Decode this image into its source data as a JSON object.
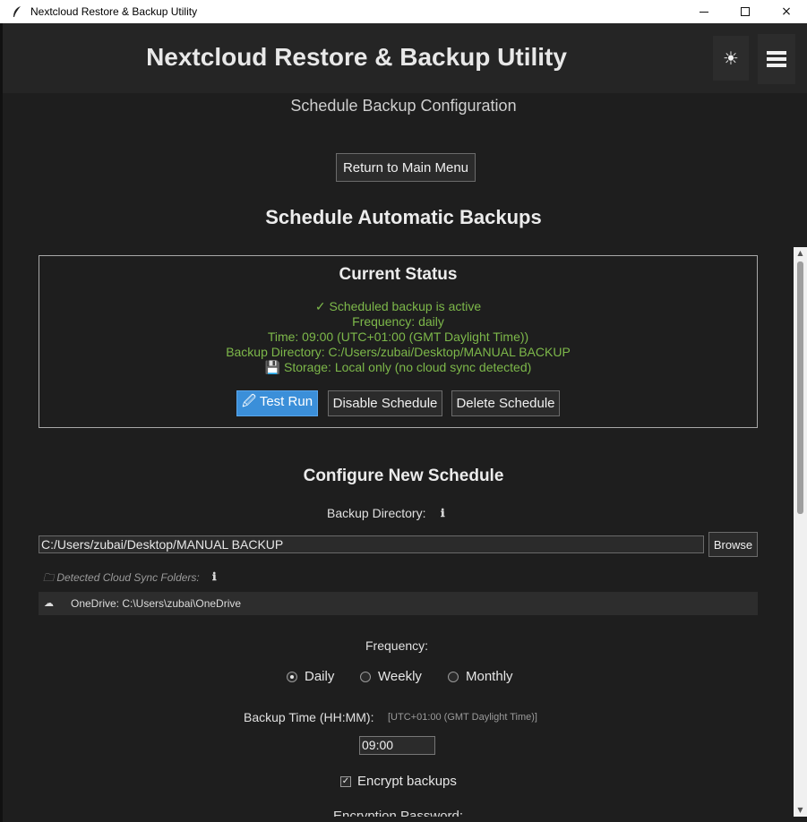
{
  "window": {
    "title": "Nextcloud Restore & Backup Utility",
    "app_icon": "feather-icon",
    "controls": {
      "minimize": "minimize-icon",
      "maximize": "maximize-icon",
      "close": "×"
    }
  },
  "header": {
    "title": "Nextcloud Restore & Backup Utility",
    "theme_icon": "☀",
    "menu_icon": "hamburger-icon"
  },
  "page": {
    "subtitle": "Schedule Backup Configuration",
    "return_label": "Return to Main Menu",
    "section_title": "Schedule Automatic Backups"
  },
  "status": {
    "title": "Current Status",
    "active": "✓ Scheduled backup is active",
    "frequency": "Frequency: daily",
    "time": "Time: 09:00 (UTC+01:00 (GMT Daylight Time))",
    "directory": "Backup Directory: C:/Users/zubai/Desktop/MANUAL BACKUP",
    "storage": "💾 Storage: Local only (no cloud sync detected)",
    "test_run_label": "🖉 Test Run",
    "disable_label": "Disable Schedule",
    "delete_label": "Delete Schedule",
    "text_color": "#7db84a",
    "accent_color": "#3b8fd9"
  },
  "config": {
    "title": "Configure New Schedule",
    "backup_dir_label": "Backup Directory:",
    "info_glyph": "ℹ",
    "backup_dir_value": "C:/Users/zubai/Desktop/MANUAL BACKUP",
    "browse_label": "Browse",
    "cloud_folders_label": "🗀 Detected Cloud Sync Folders:",
    "cloud_icon": "☁",
    "cloud_folders": [
      {
        "text": "OneDrive: C:\\Users\\zubai\\OneDrive"
      }
    ],
    "frequency_label": "Frequency:",
    "frequency_options": [
      {
        "label": "Daily",
        "selected": true
      },
      {
        "label": "Weekly",
        "selected": false
      },
      {
        "label": "Monthly",
        "selected": false
      }
    ],
    "time_label": "Backup Time (HH:MM):",
    "timezone_note": "[UTC+01:00 (GMT Daylight Time)]",
    "time_value": "09:00",
    "encrypt_label": "Encrypt backups",
    "encrypt_checked": true,
    "partial_label": "Encryption Password:"
  }
}
